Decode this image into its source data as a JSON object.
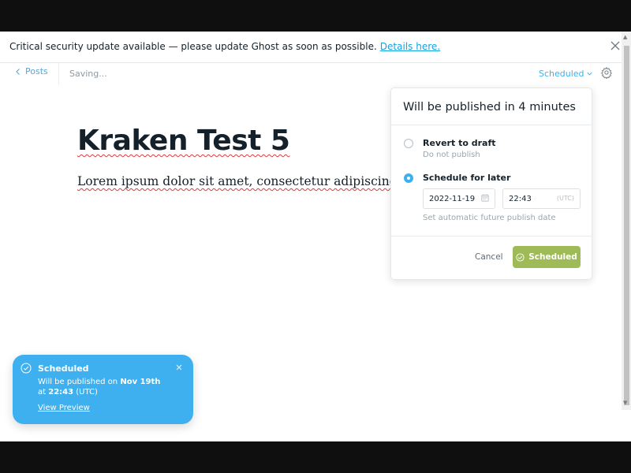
{
  "alert": {
    "message": "Critical security update available — please update Ghost as soon as possible.",
    "link": "Details here.",
    "close_icon": "close-icon"
  },
  "editor": {
    "back_label": "Posts",
    "saving_status": "Saving...",
    "post_status": "Scheduled",
    "settings_icon": "gear-icon",
    "title": "Kraken Test 5",
    "body": "Lorem ipsum dolor sit amet, consectetur adipiscing elit."
  },
  "publish_menu": {
    "title": "Will be published in 4 minutes",
    "options": [
      {
        "label": "Revert to draft",
        "description": "Do not publish",
        "selected": false
      },
      {
        "label": "Schedule for later",
        "description": "",
        "selected": true
      }
    ],
    "date_value": "2022-11-19",
    "time_value": "22:43",
    "timezone": "(UTC)",
    "hint": "Set automatic future publish date",
    "cancel_label": "Cancel",
    "confirm_label": "Scheduled",
    "confirm_color": "#9fbb58"
  },
  "notification": {
    "title": "Scheduled",
    "line1_prefix": "Will be published on",
    "line1_date": "Nov 19th",
    "line2_prefix": "at",
    "line2_time": "22:43",
    "line2_suffix": "(UTC)",
    "link": "View Preview",
    "background_color": "#3eb0ef"
  }
}
